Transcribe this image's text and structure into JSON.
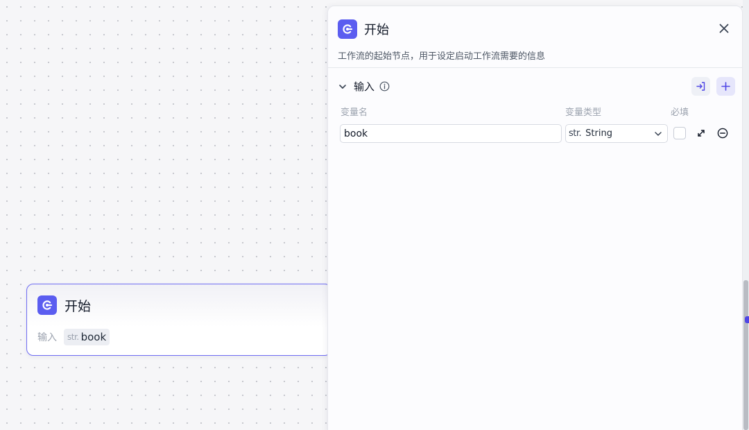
{
  "node": {
    "title": "开始",
    "input_label": "输入",
    "var_type": "str.",
    "var_name": "book"
  },
  "panel": {
    "title": "开始",
    "description": "工作流的起始节点，用于设定启动工作流需要的信息",
    "section_title": "输入",
    "columns": {
      "name": "变量名",
      "type": "变量类型",
      "required": "必填"
    },
    "row": {
      "name_value": "book",
      "type_prefix": "str.",
      "type_value": "String",
      "required": false
    }
  },
  "icons": {
    "logo": "start-logo-icon",
    "close": "close-icon",
    "collapse": "chevron-down-icon",
    "info": "info-icon",
    "import": "import-icon",
    "add": "plus-icon",
    "expand": "expand-icon",
    "remove": "minus-circle-icon"
  },
  "colors": {
    "accent": "#5b5df0",
    "node_border": "#6e6bf2"
  }
}
